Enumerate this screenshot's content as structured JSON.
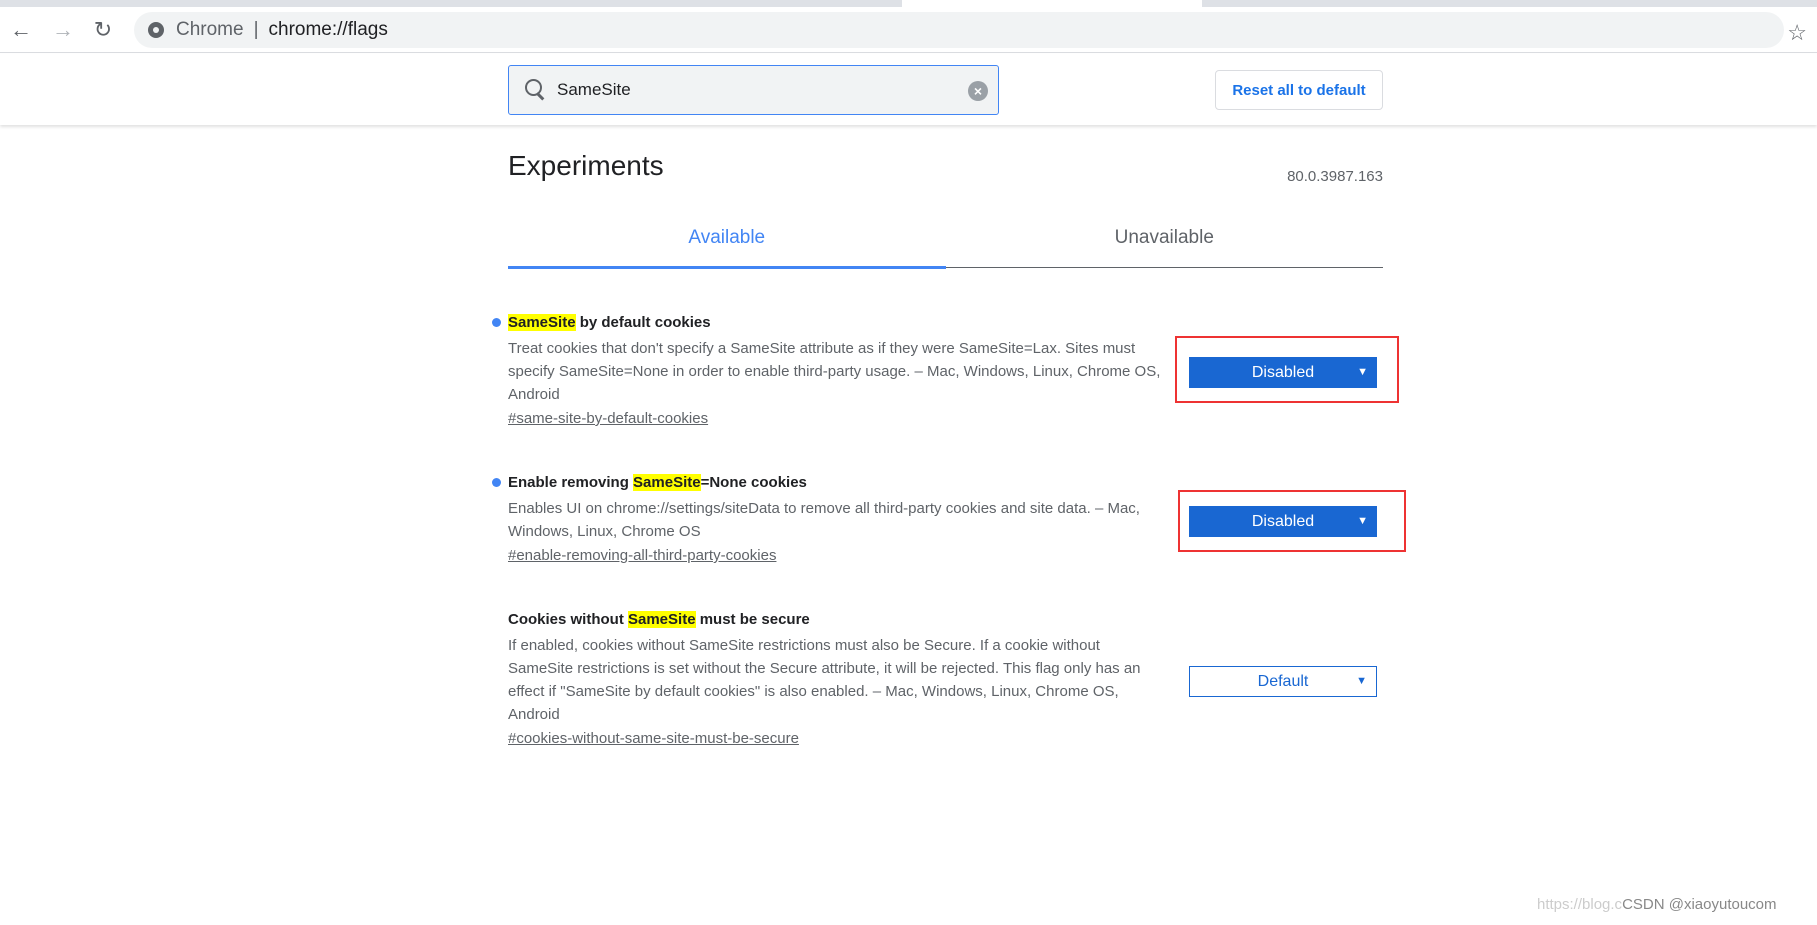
{
  "browser": {
    "omnibox_prefix": "Chrome",
    "omnibox_url": "chrome://flags"
  },
  "header": {
    "search_value": "SameSite",
    "reset_label": "Reset all to default"
  },
  "page": {
    "title": "Experiments",
    "version": "80.0.3987.163"
  },
  "tabs": [
    {
      "label": "Available",
      "selected": true
    },
    {
      "label": "Unavailable",
      "selected": false
    }
  ],
  "flags": [
    {
      "title_pre": "",
      "title_hl": "SameSite",
      "title_post": " by default cookies",
      "modified": true,
      "description": "Treat cookies that don't specify a SameSite attribute as if they were SameSite=Lax. Sites must specify SameSite=None in order to enable third-party usage. – Mac, Windows, Linux, Chrome OS, Android",
      "link": "#same-site-by-default-cookies",
      "value": "Disabled"
    },
    {
      "title_pre": "Enable removing ",
      "title_hl": "SameSite",
      "title_post": "=None cookies",
      "modified": true,
      "description": "Enables UI on chrome://settings/siteData to remove all third-party cookies and site data. – Mac, Windows, Linux, Chrome OS",
      "link": "#enable-removing-all-third-party-cookies",
      "value": "Disabled"
    },
    {
      "title_pre": "Cookies without ",
      "title_hl": "SameSite",
      "title_post": " must be secure",
      "modified": false,
      "description": "If enabled, cookies without SameSite restrictions must also be Secure. If a cookie without SameSite restrictions is set without the Secure attribute, it will be rejected. This flag only has an effect if \"SameSite by default cookies\" is also enabled. – Mac, Windows, Linux, Chrome OS, Android",
      "link": "#cookies-without-same-site-must-be-secure",
      "value": "Default"
    }
  ],
  "watermark": {
    "url": "https://blog.c",
    "credit": "CSDN @xiaoyutoucom"
  },
  "colors": {
    "accent": "#1967d2",
    "highlight": "#ffff00",
    "annotation": "#ee3333"
  }
}
